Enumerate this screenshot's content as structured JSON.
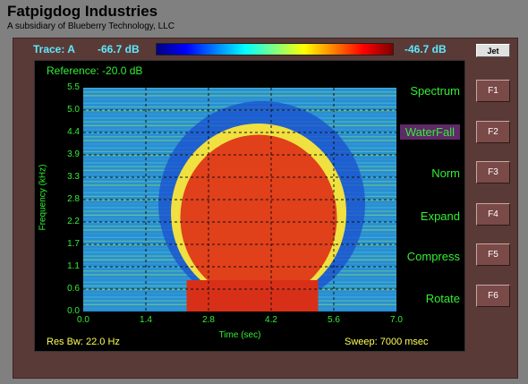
{
  "header": {
    "title": "Fatpigdog Industries",
    "subtitle": "A subsidiary of Blueberry Technology, LLC"
  },
  "trace": {
    "label": "Trace: A",
    "min_db": "-66.7 dB",
    "max_db": "-46.7 dB",
    "colormap_button": "Jet"
  },
  "display": {
    "reference": "Reference: -20.0 dB",
    "res_bw": "Res Bw:  22.0 Hz",
    "sweep": "Sweep:  7000 msec"
  },
  "menu": {
    "items": [
      {
        "label": "Spectrum",
        "key": "F1"
      },
      {
        "label": "WaterFall",
        "key": "F2",
        "active": true
      },
      {
        "label": "Norm",
        "key": "F3"
      },
      {
        "label": "Expand",
        "key": "F4"
      },
      {
        "label": "Compress",
        "key": "F5"
      },
      {
        "label": "Rotate",
        "key": "F6"
      }
    ]
  },
  "chart_data": {
    "type": "heatmap",
    "xlabel": "Time (sec)",
    "ylabel": "Frequency (kHz)",
    "x_ticks": [
      "0.0",
      "1.4",
      "2.8",
      "4.2",
      "5.6",
      "7.0"
    ],
    "y_ticks": [
      "5.5",
      "5.0",
      "4.4",
      "3.9",
      "3.3",
      "2.8",
      "2.2",
      "1.7",
      "1.1",
      "0.6",
      "0.0"
    ],
    "xlim": [
      0,
      7.0
    ],
    "ylim": [
      0,
      5.5
    ],
    "colormap": "jet",
    "color_range_db": [
      -66.7,
      -46.7
    ],
    "grid": true,
    "colors": {
      "grid": "#111111",
      "text": "#33ee33",
      "background": "#2a8fd0",
      "face": "#e0401a"
    }
  }
}
